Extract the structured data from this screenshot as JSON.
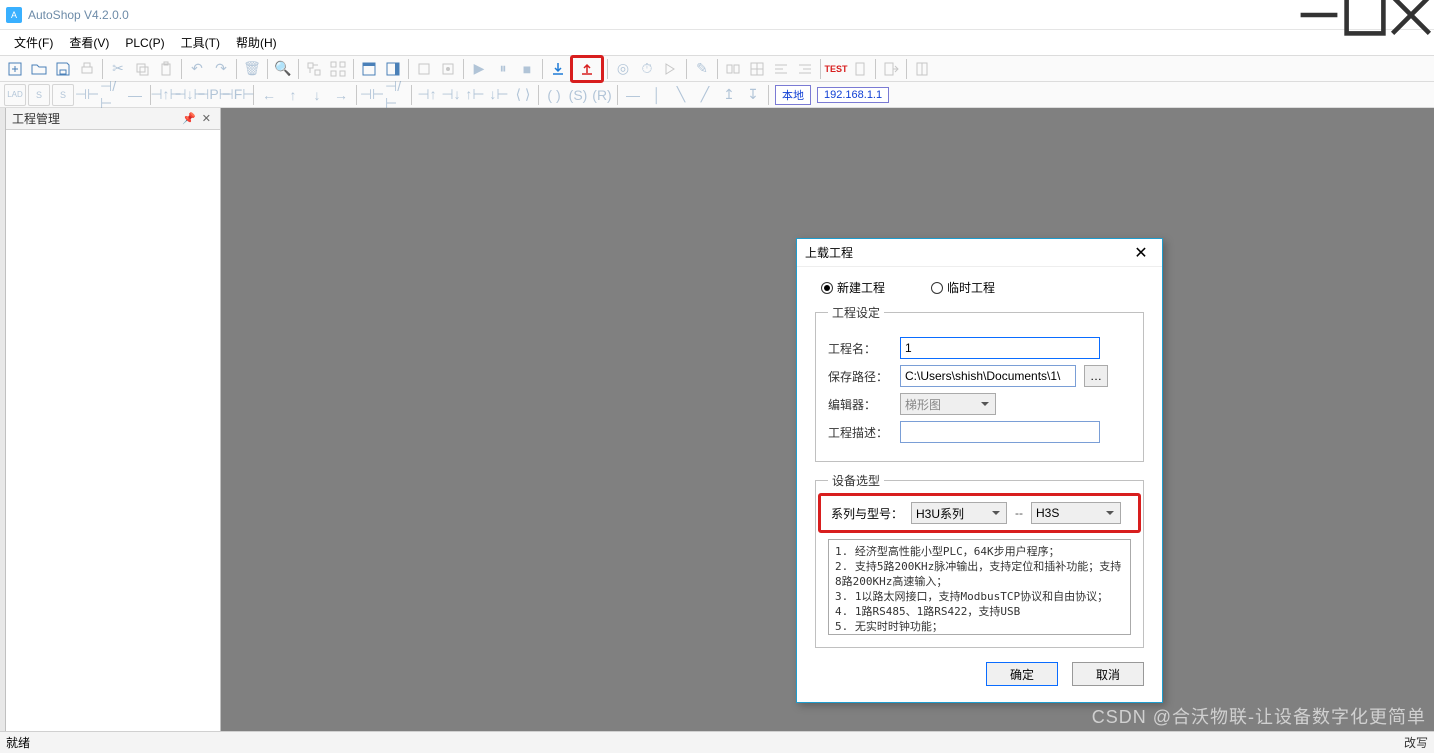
{
  "app": {
    "title": "AutoShop V4.2.0.0"
  },
  "menu": {
    "file": "文件(F)",
    "view": "查看(V)",
    "plc": "PLC(P)",
    "tools": "工具(T)",
    "help": "帮助(H)"
  },
  "toolbar2_tags": {
    "local": "本地",
    "ip": "192.168.1.1"
  },
  "panel": {
    "title": "工程管理"
  },
  "status": {
    "left": "就绪",
    "right": "改写"
  },
  "dialog": {
    "title": "上载工程",
    "radio_new": "新建工程",
    "radio_temp": "临时工程",
    "fs_project": "工程设定",
    "lbl_name": "工程名：",
    "val_name": "1",
    "lbl_path": "保存路径：",
    "val_path": "C:\\Users\\shish\\Documents\\1\\",
    "lbl_editor": "编辑器：",
    "val_editor": "梯形图",
    "lbl_desc": "工程描述：",
    "val_desc": "",
    "fs_device": "设备选型",
    "lbl_series": "系列与型号：",
    "val_series": "H3U系列",
    "val_model": "H3S",
    "spec_lines": [
      "1. 经济型高性能小型PLC，64K步用户程序；",
      "2. 支持5路200KHz脉冲输出，支持定位和插补功能；支持8路200KHz高速输入；",
      "3. 1以路太网接口，支持ModbusTCP协议和自由协议；",
      "4. 1路RS485、1路RS422，支持USB",
      "5. 无实时时钟功能；"
    ],
    "btn_ok": "确定",
    "btn_cancel": "取消"
  },
  "watermark": "CSDN @合沃物联-让设备数字化更简单"
}
